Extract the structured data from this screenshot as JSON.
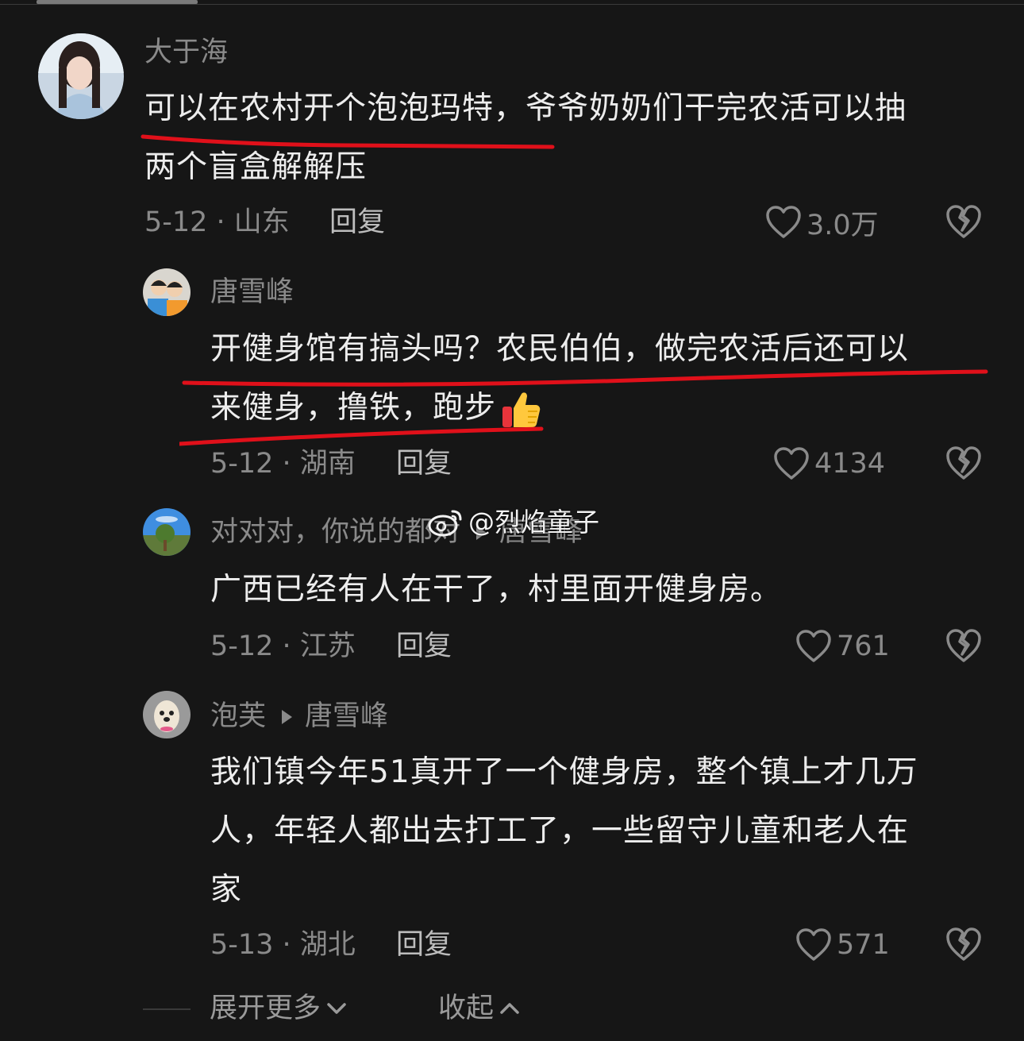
{
  "colors": {
    "background": "#161616",
    "underline": "#e0101a",
    "muted": "#8a8a8a"
  },
  "comments": [
    {
      "author": "大于海",
      "text_line1": "可以在农村开个泡泡玛特，爷爷奶奶们干完农活可以抽",
      "text_line2": "两个盲盒解解压",
      "meta": "5-12 · 山东",
      "reply": "回复",
      "likes": "3.0万"
    },
    {
      "author": "唐雪峰",
      "text_line1": "开健身馆有搞头吗？农民伯伯，做完农活后还可以",
      "text_line2": "来健身，撸铁，跑步",
      "emoji": "thumbs-up-icon",
      "meta": "5-12 · 湖南",
      "reply": "回复",
      "likes": "4134"
    },
    {
      "author": "对对对，你说的都对",
      "reply_to": "唐雪峰",
      "text_line1": "广西已经有人在干了，村里面开健身房。",
      "meta": "5-12 · 江苏",
      "reply": "回复",
      "likes": "761"
    },
    {
      "author": "泡芙",
      "reply_to": "唐雪峰",
      "text_line1": "我们镇今年51真开了一个健身房，整个镇上才几万",
      "text_line2": "人，年轻人都出去打工了，一些留守儿童和老人在",
      "text_line3": "家",
      "meta": "5-13 · 湖北",
      "reply": "回复",
      "likes": "571"
    }
  ],
  "watermark": "@烈焰童子",
  "footer": {
    "expand": "展开更多",
    "collapse": "收起"
  }
}
